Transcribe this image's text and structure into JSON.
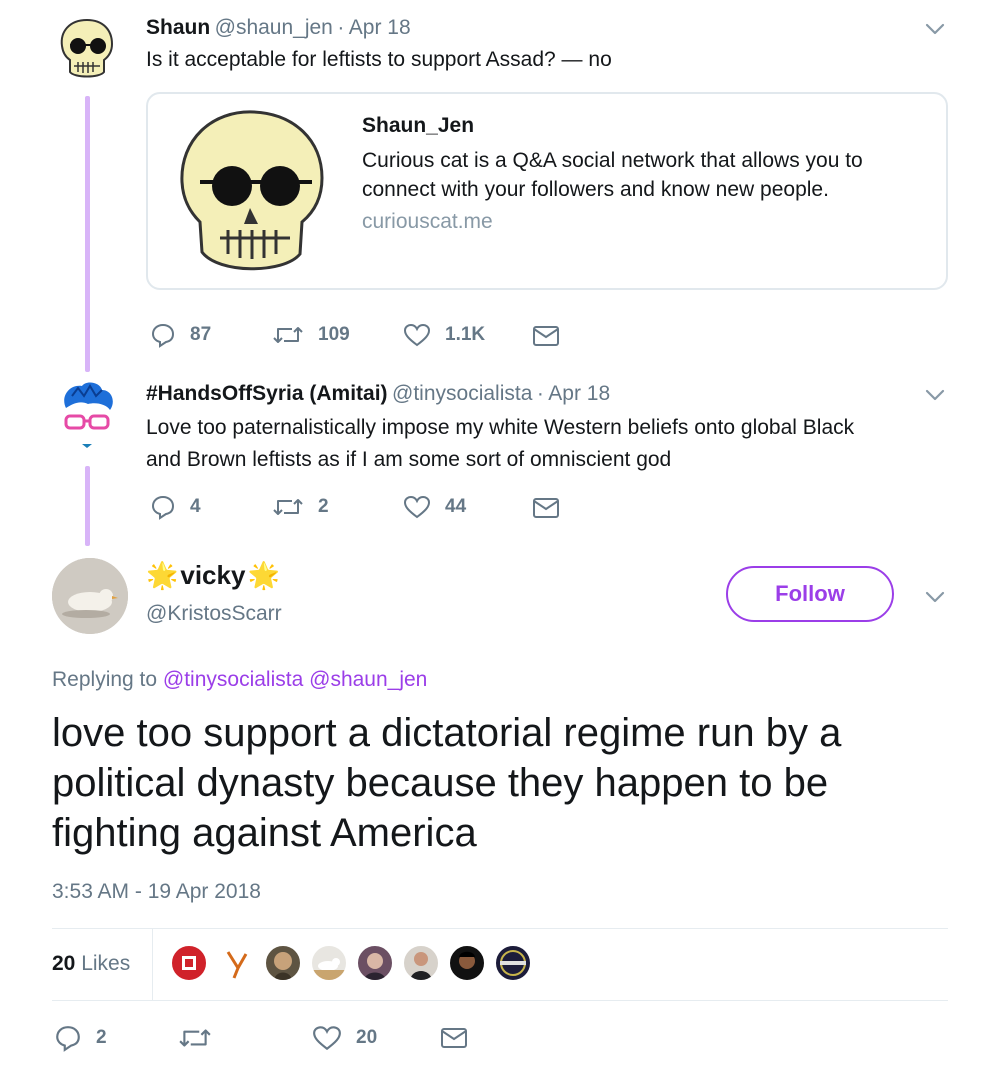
{
  "tweet1": {
    "display_name": "Shaun",
    "handle": "@shaun_jen",
    "date": "Apr 18",
    "text": "Is it acceptable for leftists to support Assad? — no",
    "card": {
      "title": "Shaun_Jen",
      "description_line1": "Curious cat is a Q&A social network that allows you to",
      "description_line2": "connect with your followers and know new people.",
      "link": "curiouscat.me"
    },
    "replies": "87",
    "retweets": "109",
    "likes": "1.1K"
  },
  "tweet2": {
    "display_name": "#HandsOffSyria (Amitai)",
    "handle": "@tinysocialista",
    "date": "Apr 18",
    "text_line1": "Love too paternalistically impose my white Western beliefs onto global Black",
    "text_line2": "and Brown leftists as if I am some sort of omniscient god",
    "replies": "4",
    "retweets": "2",
    "likes": "44"
  },
  "main_tweet": {
    "display_name": "vicky",
    "name_emoji": "🌟",
    "handle": "@KristosScarr",
    "follow_label": "Follow",
    "replying_prefix": "Replying to",
    "mention1": "@tinysocialista",
    "mention2": "@shaun_jen",
    "text_line1": "love too support a dictatorial regime run by a",
    "text_line2": "political dynasty because they happen to be",
    "text_line3": "fighting against America",
    "timestamp": "3:53 AM - 19 Apr 2018",
    "likes_count": "20",
    "likes_word": "Likes",
    "replies": "2",
    "likes": "20"
  },
  "colors": {
    "accent": "#9b3ee8",
    "thread_line": "#d8b4f8",
    "muted": "#657786",
    "border": "#e1e8ed"
  },
  "icons": [
    "reply-icon",
    "retweet-icon",
    "like-icon",
    "dm-icon",
    "chevron-down-icon"
  ]
}
